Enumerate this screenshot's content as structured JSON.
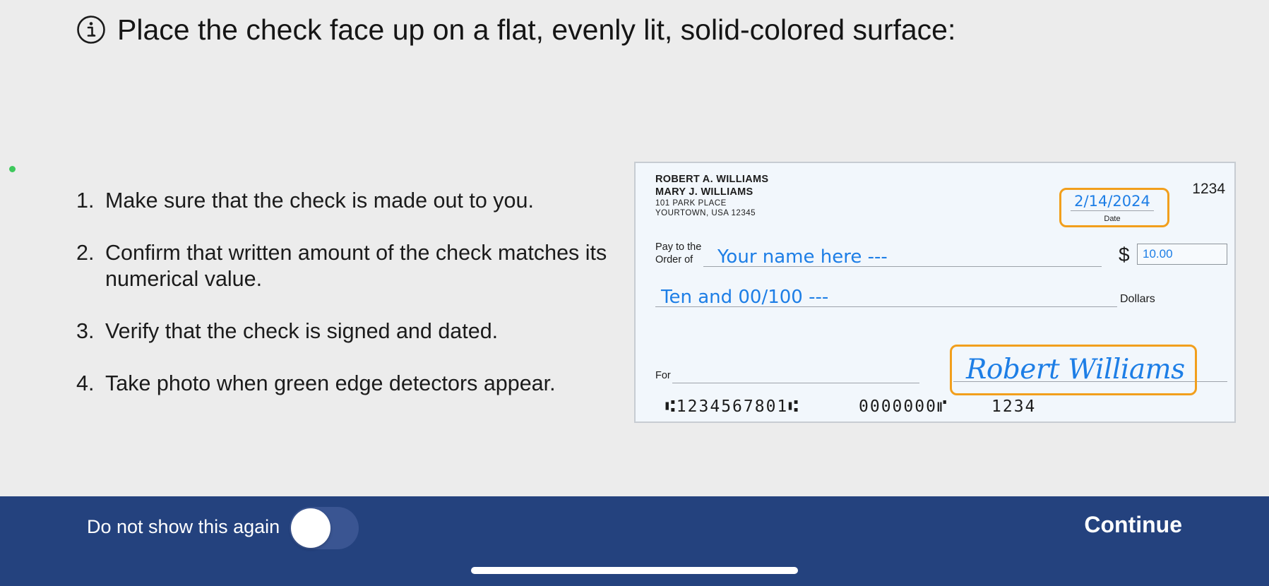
{
  "header": {
    "title": "Place the check face up on a flat, evenly lit, solid-colored surface:",
    "icon": "info-icon"
  },
  "instructions": [
    {
      "number": "1.",
      "text": "Make sure that the check is made out to you."
    },
    {
      "number": "2.",
      "text": "Confirm that written amount of the check matches its numerical value."
    },
    {
      "number": "3.",
      "text": "Verify that the check is signed and dated."
    },
    {
      "number": "4.",
      "text": "Take photo when green edge detectors appear."
    }
  ],
  "check": {
    "owner_line_1": "ROBERT A. WILLIAMS",
    "owner_line_2": "MARY J. WILLIAMS",
    "address_line_1": "101 PARK PLACE",
    "address_line_2": "YOURTOWN, USA 12345",
    "check_number": "1234",
    "date_value": "2/14/2024",
    "date_label": "Date",
    "pay_label_1": "Pay to the",
    "pay_label_2": "Order of",
    "payee": "Your name here ---",
    "dollar_sign": "$",
    "amount": "10.00",
    "written_amount": "Ten and 00/100 ---",
    "dollars_label": "Dollars",
    "for_label": "For",
    "signature": "Robert Williams",
    "micr_routing": "⑆1234567801⑆",
    "micr_account": "0000000⑈",
    "micr_check": "1234"
  },
  "footer": {
    "dont_show_label": "Do not show this again",
    "toggle_on": false,
    "continue_label": "Continue"
  },
  "colors": {
    "footer_background": "#24427e",
    "page_background": "#ececec",
    "handwritten_blue": "#1d7ee6",
    "highlight_orange": "#f29f1c",
    "edge_detector_green": "#3ec85c"
  }
}
